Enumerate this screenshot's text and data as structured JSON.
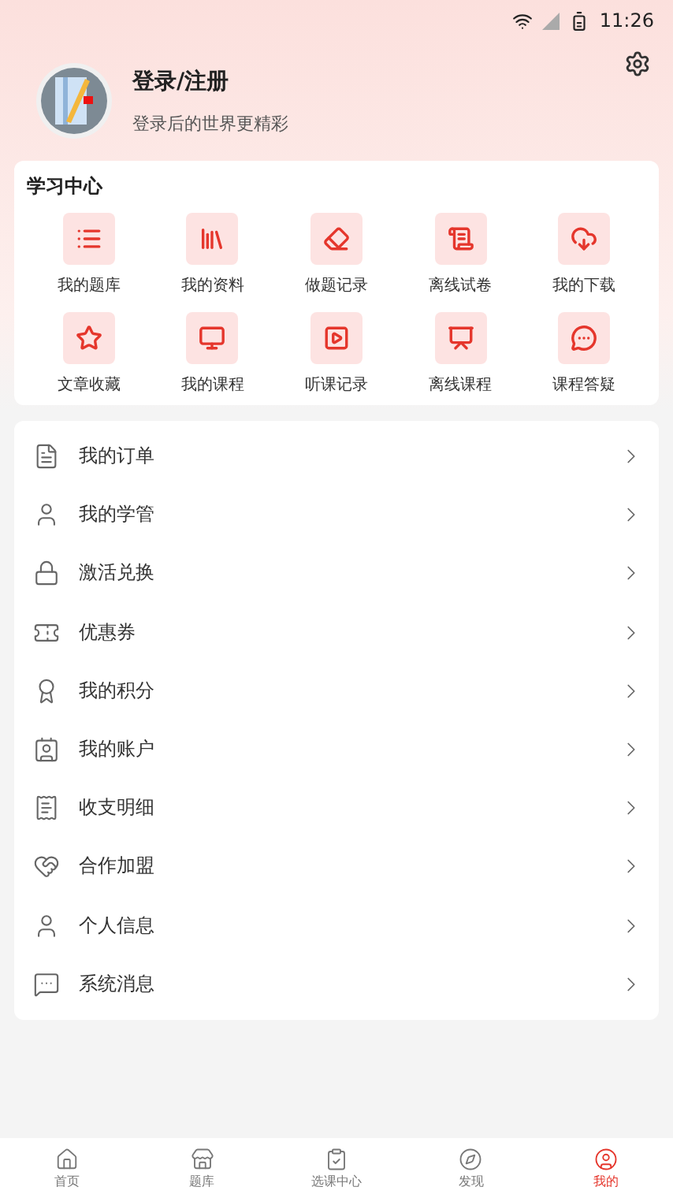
{
  "status_bar": {
    "time": "11:26"
  },
  "profile": {
    "title": "登录/注册",
    "subtitle": "登录后的世界更精彩"
  },
  "study_center": {
    "title": "学习中心",
    "items": [
      {
        "label": "我的题库"
      },
      {
        "label": "我的资料"
      },
      {
        "label": "做题记录"
      },
      {
        "label": "离线试卷"
      },
      {
        "label": "我的下载"
      },
      {
        "label": "文章收藏"
      },
      {
        "label": "我的课程"
      },
      {
        "label": "听课记录"
      },
      {
        "label": "离线课程"
      },
      {
        "label": "课程答疑"
      }
    ]
  },
  "menu": [
    {
      "label": "我的订单"
    },
    {
      "label": "我的学管"
    },
    {
      "label": "激活兑换"
    },
    {
      "label": "优惠券"
    },
    {
      "label": "我的积分"
    },
    {
      "label": "我的账户"
    },
    {
      "label": "收支明细"
    },
    {
      "label": "合作加盟"
    },
    {
      "label": "个人信息"
    },
    {
      "label": "系统消息"
    }
  ],
  "bottom_nav": [
    {
      "label": "首页",
      "selected": false
    },
    {
      "label": "题库",
      "selected": false
    },
    {
      "label": "选课中心",
      "selected": false
    },
    {
      "label": "发现",
      "selected": false
    },
    {
      "label": "我的",
      "selected": true
    }
  ]
}
